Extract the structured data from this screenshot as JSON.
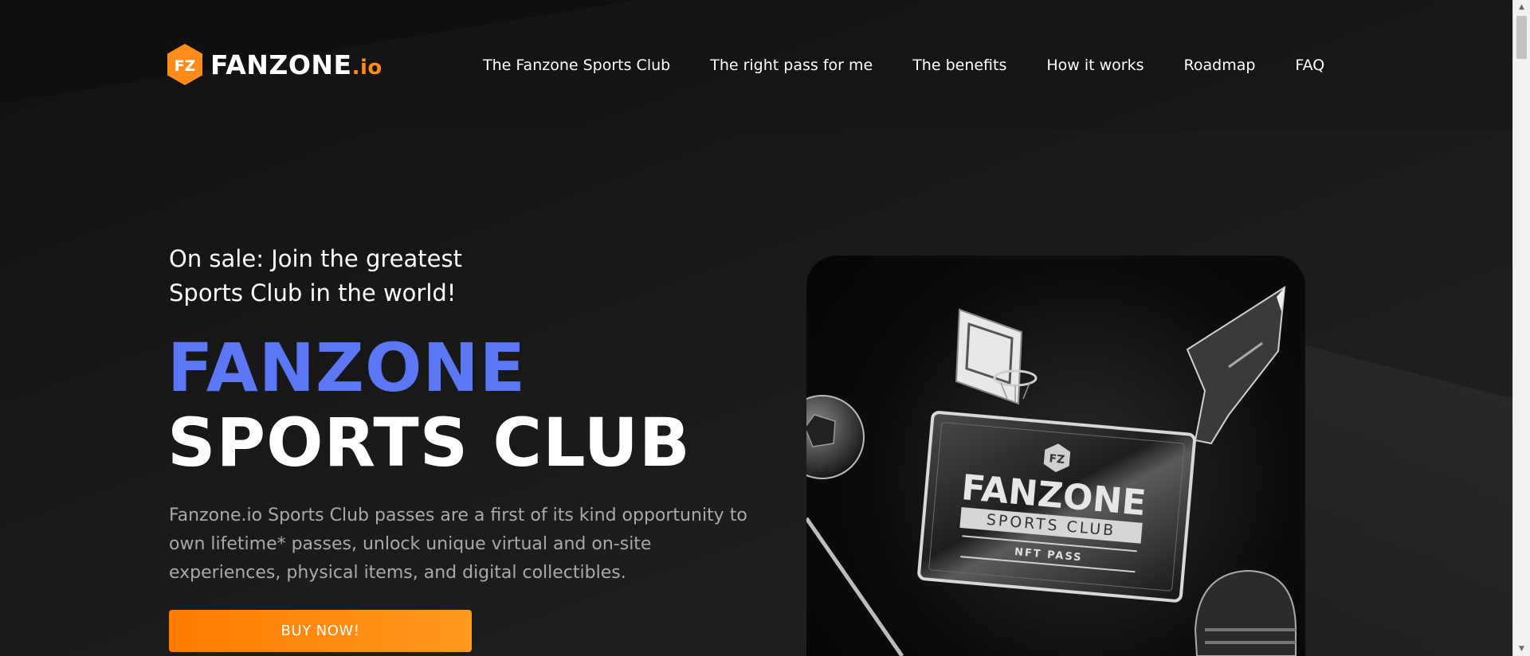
{
  "header": {
    "logo_text": "FANZONE",
    "logo_suffix": ".io",
    "logo_mark": "FZ",
    "nav": [
      {
        "label": "The Fanzone Sports Club"
      },
      {
        "label": "The right pass for me"
      },
      {
        "label": "The benefits"
      },
      {
        "label": "How it works"
      },
      {
        "label": "Roadmap"
      },
      {
        "label": "FAQ"
      }
    ]
  },
  "hero": {
    "tagline_line1": "On sale: Join the greatest",
    "tagline_line2": "Sports Club in the world!",
    "title_line1": "FANZONE",
    "title_line2": "SPORTS CLUB",
    "description": "Fanzone.io Sports Club passes are a first of its kind opportunity to own lifetime* passes, unlock unique virtual and on-site experiences, physical items, and digital collectibles.",
    "buy_button": "BUY NOW!"
  },
  "card": {
    "badge": "FZ",
    "brand": "FANZONE",
    "subtitle": "SPORTS CLUB",
    "pass_label": "NFT PASS"
  },
  "colors": {
    "accent_blue": "#5c77f5",
    "accent_orange": "#ff8b1a",
    "background": "#1b1b1b"
  },
  "icons": {
    "logo": "hexagon-fz-icon",
    "scroll_up": "triangle-up-icon",
    "scroll_down": "triangle-down-icon"
  }
}
